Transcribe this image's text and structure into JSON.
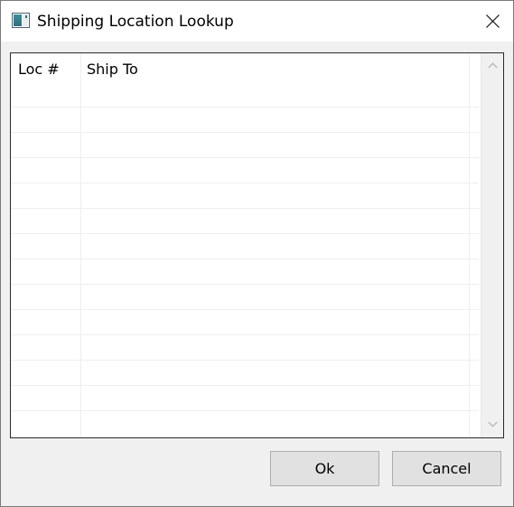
{
  "window": {
    "title": "Shipping Location Lookup",
    "icon": "app-window-icon",
    "close_icon": "close-icon"
  },
  "grid": {
    "columns": [
      "Loc #",
      "Ship To"
    ],
    "rows": [],
    "scrollbar": {
      "up_icon": "chevron-up-icon",
      "down_icon": "chevron-down-icon"
    }
  },
  "buttons": {
    "ok_label": "Ok",
    "cancel_label": "Cancel"
  }
}
